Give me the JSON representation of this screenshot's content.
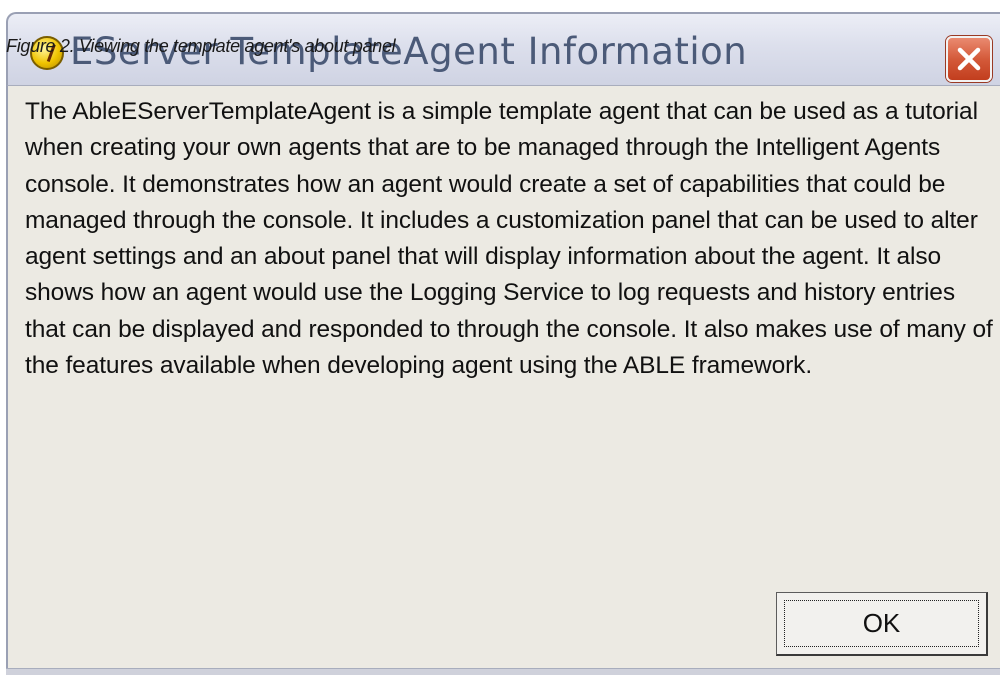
{
  "caption": "Figure 2. Viewing the template agent's about panel",
  "window": {
    "title": "EServer TemplateAgent Information",
    "app_icon": "yellow-agent-icon",
    "close_icon": "close-x-icon"
  },
  "message": "The AbleEServerTemplateAgent is a simple template agent that can be used as a tutorial when creating your own agents that are to be managed through the Intelligent Agents console.  It demonstrates how an agent would create a set of capabilities that could be managed through the console.  It includes a customization panel that can be used to alter agent settings and an about panel that will display information about the agent.  It also shows how an agent would use the Logging Service to log requests and history entries that can be displayed and responded to through the console.  It also makes use of many of the features available when developing agent using the ABLE framework.",
  "buttons": {
    "ok_label": "OK"
  },
  "colors": {
    "close_button": "#d45a3a",
    "client_background": "#eceae3",
    "title_text": "#4b5a78"
  }
}
